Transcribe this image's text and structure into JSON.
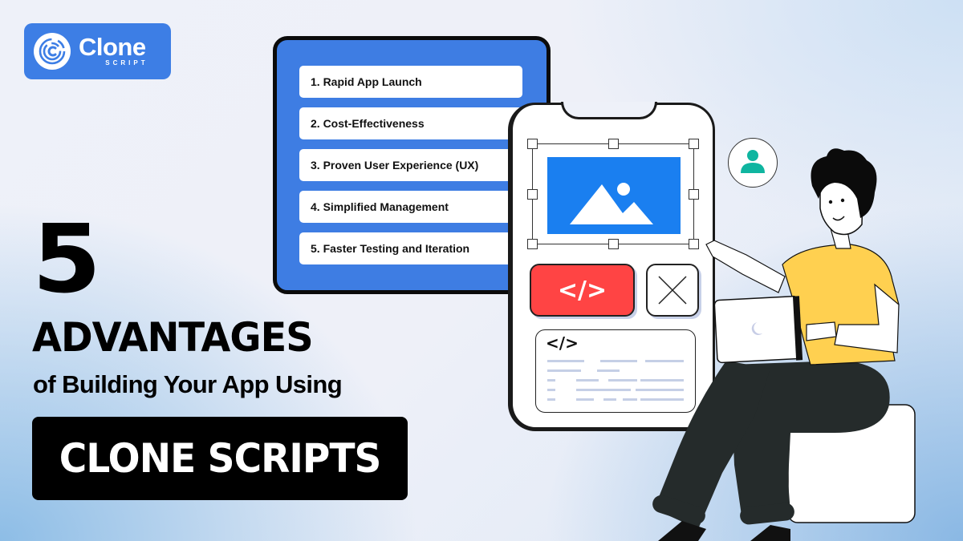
{
  "brand": {
    "name": "Clone",
    "sub": "SCRIPT",
    "color": "#3d7ee5"
  },
  "headline": {
    "number": "5",
    "title": "ADVANTAGES",
    "subtitle": "of Building Your App Using",
    "highlight": "CLONE SCRIPTS"
  },
  "advantages": [
    {
      "label": "1. Rapid App Launch"
    },
    {
      "label": "2. Cost-Effectiveness"
    },
    {
      "label": "3. Proven User Experience (UX)"
    },
    {
      "label": "4. Simplified Management"
    },
    {
      "label": "5. Faster Testing and Iteration"
    }
  ],
  "phone": {
    "code_button_label": "</>",
    "code_card_tag": "</>"
  },
  "icons": {
    "logo": "clone-script-logo-icon",
    "image": "image-placeholder-icon",
    "close": "close-x-icon",
    "user": "user-avatar-icon"
  },
  "colors": {
    "accent_blue": "#3e7de3",
    "image_blue": "#1a7ff0",
    "code_red": "#ff4444",
    "user_teal": "#0fb5a0",
    "shirt_yellow": "#ffd050",
    "pants_dark": "#252b2b"
  }
}
